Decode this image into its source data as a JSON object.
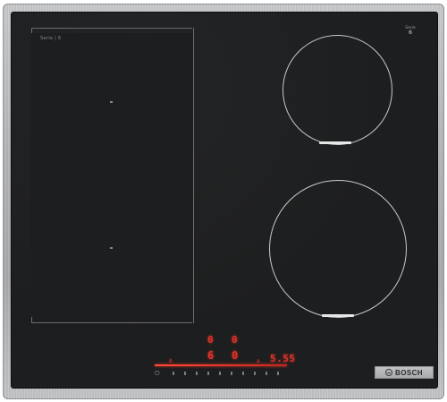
{
  "hob": {
    "model_label": "Serie | 6",
    "model_sub": "",
    "series_badge_top": "Serie",
    "series_badge_num": "6",
    "brand": "BOSCH"
  },
  "controls": {
    "zone_front_left_level": "0",
    "zone_front_right_level": "0",
    "zone_rear_left_level": "6",
    "zone_rear_right_level": "0",
    "timer": "5.55",
    "label_left": "A",
    "label_mid": "a",
    "label_right": "a"
  },
  "colors": {
    "glass": "#1d1e1f",
    "display_red": "#e3322b",
    "ring": "#c8c9cb",
    "frame": "#b3b5b8"
  },
  "icons": [
    "power-icon",
    "bosch-logo-icon"
  ]
}
